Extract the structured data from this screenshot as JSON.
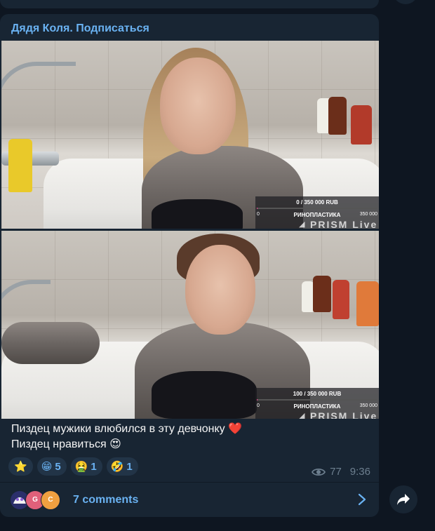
{
  "post": {
    "sender": "Дядя Коля. Подписаться",
    "caption_line1": "Пиздец мужики влюбился в эту девчонку ❤️",
    "caption_line2": "Пиздец нравиться 😍",
    "views": "77",
    "time": "9:36"
  },
  "photos": [
    {
      "overlay_amount": "0 / 350 000 RUB",
      "overlay_progress": 0,
      "overlay_low": "0",
      "overlay_name": "РИНОПЛАСТИКА",
      "overlay_high": "350 000",
      "overlay_logo": "PRISM Live"
    },
    {
      "overlay_amount": "100 / 350 000 RUB",
      "overlay_progress": 0.0003,
      "overlay_low": "0",
      "overlay_name": "РИНОПЛАСТИКА",
      "overlay_high": "350 000",
      "overlay_logo": "PRISM Live"
    }
  ],
  "reactions": [
    {
      "emoji": "⭐",
      "count": ""
    },
    {
      "emoji": "😁",
      "count": "5"
    },
    {
      "emoji": "🤮",
      "count": "1"
    },
    {
      "emoji": "🤣",
      "count": "1"
    }
  ],
  "comments": {
    "label": "7 comments",
    "avatars": [
      {
        "letter": "",
        "color": "#3a3f8f"
      },
      {
        "letter": "G",
        "color": "#e0607a"
      },
      {
        "letter": "C",
        "color": "#f0a040"
      }
    ]
  },
  "icons": {
    "views": "eye-icon",
    "comments_arrow": "chevron-right-icon",
    "share": "share-arrow-icon"
  },
  "colors": {
    "background": "#0e1621",
    "bubble": "#182533",
    "accent": "#6ab2f2",
    "meta": "#6d7f8f"
  }
}
